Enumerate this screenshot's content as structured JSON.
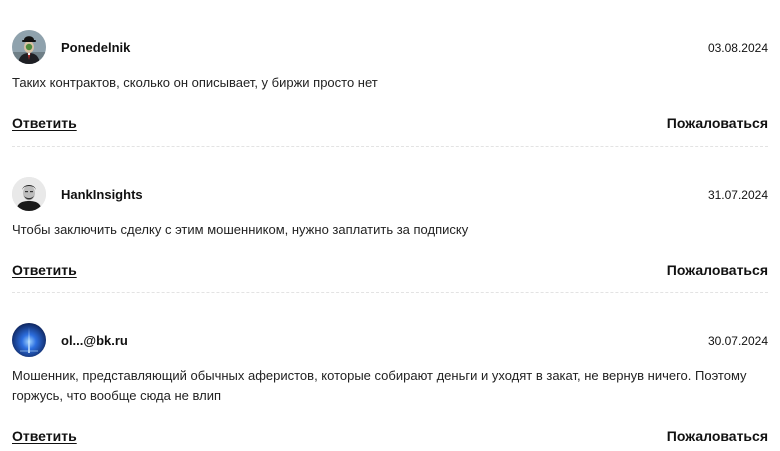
{
  "comments": [
    {
      "author": "Ponedelnik",
      "date": "03.08.2024",
      "text": "Таких контрактов, сколько он описывает, у биржи просто нет",
      "reply_label": "Ответить",
      "report_label": "Пожаловаться"
    },
    {
      "author": "HankInsights",
      "date": "31.07.2024",
      "text": "Чтобы заключить сделку с этим мошенником, нужно заплатить за подписку",
      "reply_label": "Ответить",
      "report_label": "Пожаловаться"
    },
    {
      "author": "ol...@bk.ru",
      "date": "30.07.2024",
      "text": "Мошенник, представляющий обычных аферистов, которые собирают деньги и уходят в закат, не вернув ничего. Поэтому горжусь, что вообще сюда не влип",
      "reply_label": "Ответить",
      "report_label": "Пожаловаться"
    }
  ]
}
